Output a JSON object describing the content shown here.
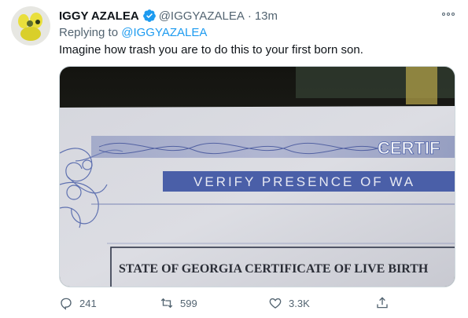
{
  "tweet": {
    "display_name": "IGGY AZALEA",
    "handle": "@IGGYAZALEA",
    "separator": "·",
    "time": "13m",
    "reply_prefix": "Replying to",
    "reply_to": "@IGGYAZALEA",
    "text": "Imagine how trash you are to do this to your first born son.",
    "media": {
      "certificate_word": "CERTIF",
      "verify_text": "VERIFY PRESENCE OF WA",
      "state_text": "STATE OF GEORGIA CERTIFICATE OF LIVE BIRTH"
    },
    "actions": {
      "replies": "241",
      "retweets": "599",
      "likes": "3.3K"
    }
  },
  "icons": {
    "verified": "verified-badge-icon",
    "more": "more-options-icon",
    "reply": "reply-icon",
    "retweet": "retweet-icon",
    "like": "heart-icon",
    "share": "share-icon"
  },
  "colors": {
    "accent": "#1d9bf0",
    "secondary_text": "#536471",
    "certificate_blue": "#4a5fa8"
  }
}
